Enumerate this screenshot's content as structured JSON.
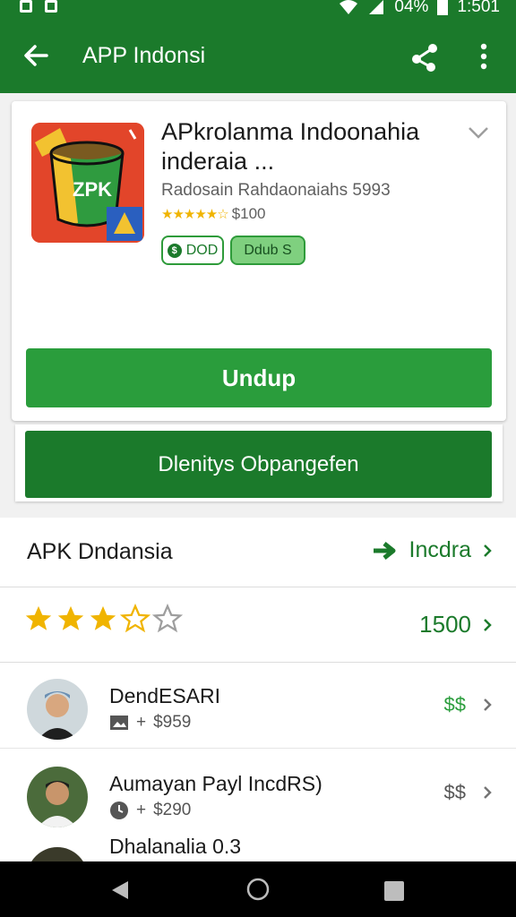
{
  "status_bar": {
    "battery": "04%",
    "time": "1:501"
  },
  "app_bar": {
    "title": "APP Indonsi"
  },
  "app_card": {
    "title_line1": "APkrolanma Indoonahia",
    "title_line2": "inderaia ...",
    "developer": "Radosain Rahdaonaiahs 5993",
    "rating_text": "$100",
    "badge_left": "DOD",
    "badge_right": "Ddub S",
    "install_label": "Undup"
  },
  "secondary_action": {
    "label": "Dlenitys Obpangefen"
  },
  "list": {
    "header": {
      "label": "APK Dndansia",
      "link": "Incdra"
    },
    "rating": {
      "stars_filled": 3,
      "stars_total": 5,
      "count": "1500"
    },
    "people": [
      {
        "name": "DendESARI",
        "meta": "$959",
        "right": "$$"
      },
      {
        "name": "Aumayan Payl IncdRS)",
        "meta": "$290",
        "right": "$$"
      },
      {
        "name": "Dhalanalia 0.3"
      }
    ]
  },
  "colors": {
    "brand_green": "#1b7a2b",
    "button_green": "#2a9d3c",
    "star": "#f0b400"
  }
}
